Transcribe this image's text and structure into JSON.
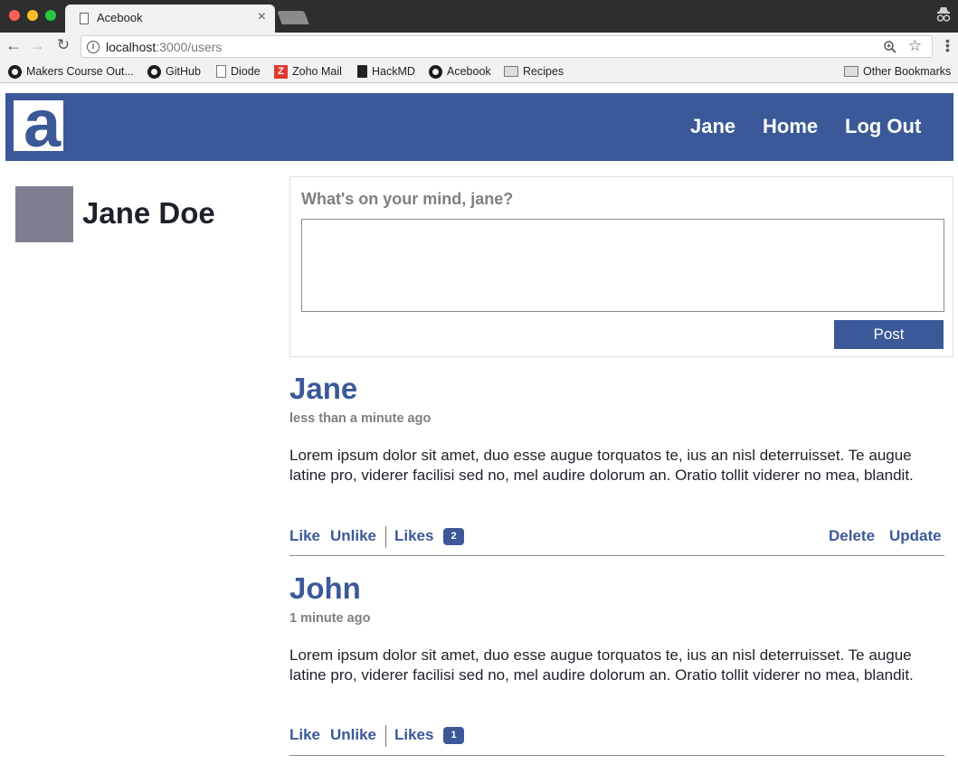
{
  "browser": {
    "tab_title": "Acebook",
    "tab_close": "×",
    "url_host": "localhost",
    "url_path": ":3000/users",
    "nav": {
      "back": "←",
      "forward": "→",
      "reload": "↻"
    },
    "star": "☆",
    "menu": "⋮",
    "bookmarks": [
      {
        "label": "Makers Course Out...",
        "icon": "github-icon"
      },
      {
        "label": "GitHub",
        "icon": "github-icon"
      },
      {
        "label": "Diode",
        "icon": "doc-icon"
      },
      {
        "label": "Zoho Mail",
        "icon": "zoho-icon"
      },
      {
        "label": "HackMD",
        "icon": "doc-filled-icon"
      },
      {
        "label": "Acebook",
        "icon": "github-icon"
      },
      {
        "label": "Recipes",
        "icon": "folder-icon"
      }
    ],
    "other_bookmarks": "Other Bookmarks",
    "zoho_letter": "Z"
  },
  "site": {
    "logo_letter": "a",
    "nav": {
      "user": "Jane",
      "home": "Home",
      "logout": "Log Out"
    },
    "brand_color": "#3b5998"
  },
  "profile": {
    "name": "Jane Doe"
  },
  "composer": {
    "prompt": "What's on your mind, jane?",
    "value": "",
    "button": "Post"
  },
  "posts": [
    {
      "author": "Jane",
      "time": "less than a minute ago",
      "body": "Lorem ipsum dolor sit amet, duo esse augue torquatos te, ius an nisl deterruisset. Te augue latine pro, viderer facilisi sed no, mel audire dolorum an. Oratio tollit viderer no mea, blandit.",
      "like": "Like",
      "unlike": "Unlike",
      "likes_label": "Likes",
      "likes_count": "2",
      "delete": "Delete",
      "update": "Update"
    },
    {
      "author": "John",
      "time": "1 minute ago",
      "body": "Lorem ipsum dolor sit amet, duo esse augue torquatos te, ius an nisl deterruisset. Te augue latine pro, viderer facilisi sed no, mel audire dolorum an. Oratio tollit viderer no mea, blandit.",
      "like": "Like",
      "unlike": "Unlike",
      "likes_label": "Likes",
      "likes_count": "1"
    }
  ]
}
